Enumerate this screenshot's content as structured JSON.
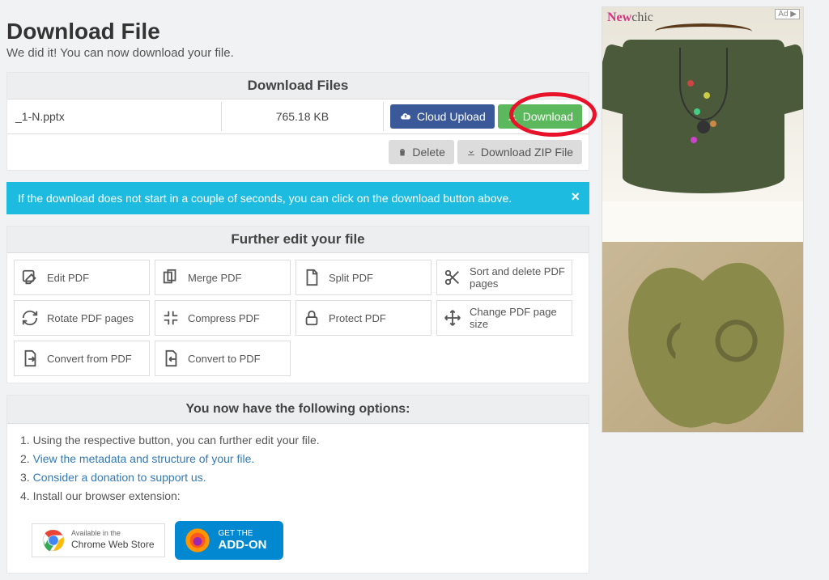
{
  "header": {
    "title": "Download File",
    "subtitle": "We did it! You can now download your file."
  },
  "download_panel": {
    "header": "Download Files",
    "file": {
      "name": "_1-N.pptx",
      "size": "765.18 KB"
    },
    "cloud_upload_label": "Cloud Upload",
    "download_label": "Download",
    "delete_label": "Delete",
    "zip_label": "Download ZIP File"
  },
  "info_bar": "If the download does not start in a couple of seconds, you can click on the download button above.",
  "tools_header": "Further edit your file",
  "tools": [
    "Edit PDF",
    "Merge PDF",
    "Split PDF",
    "Sort and delete PDF pages",
    "Rotate PDF pages",
    "Compress PDF",
    "Protect PDF",
    "Change PDF page size",
    "Convert from PDF",
    "Convert to PDF"
  ],
  "options": {
    "title": "You now have the following options:",
    "item1": "Using the respective button, you can further edit your file.",
    "item2_link": "View the metadata and structure of your file.",
    "item3_link": "Consider a donation to support us.",
    "item4": "Install our browser extension:",
    "chrome_small": "Available in the",
    "chrome_main": "Chrome Web Store",
    "ff_small": "GET THE",
    "ff_main": "ADD-ON"
  },
  "ad": {
    "label": "Ad",
    "brand_new": "New",
    "brand_chic": "chic"
  }
}
